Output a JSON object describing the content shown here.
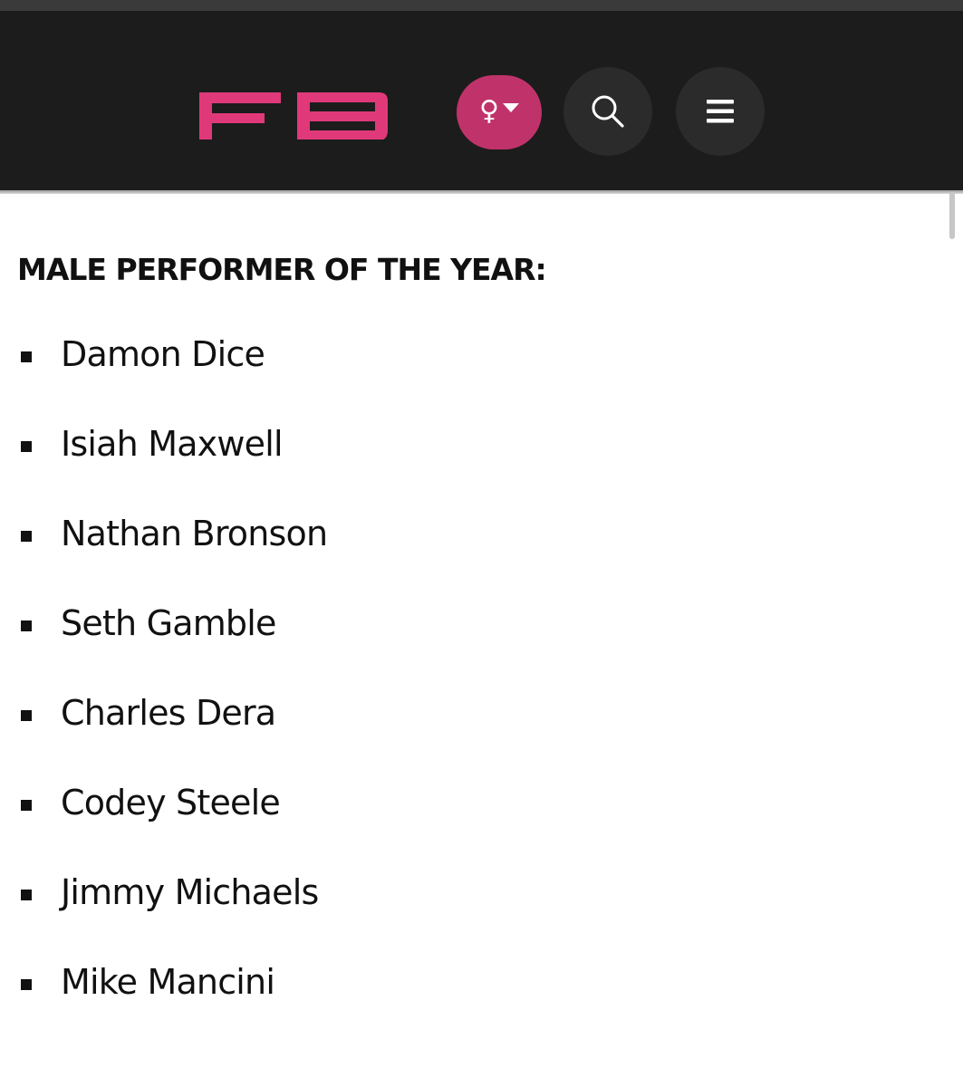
{
  "header": {
    "logo_text": "FB",
    "brand_color": "#e0397a",
    "gender_symbol": "♀",
    "icons": {
      "gender": "female-icon",
      "dropdown": "caret-down-icon",
      "search": "search-icon",
      "menu": "hamburger-menu-icon"
    }
  },
  "main": {
    "section_title": "MALE PERFORMER OF THE YEAR:",
    "nominees": [
      "Damon Dice",
      "Isiah Maxwell",
      "Nathan Bronson",
      "Seth Gamble",
      "Charles Dera",
      "Codey Steele",
      "Jimmy Michaels",
      "Mike Mancini"
    ]
  }
}
